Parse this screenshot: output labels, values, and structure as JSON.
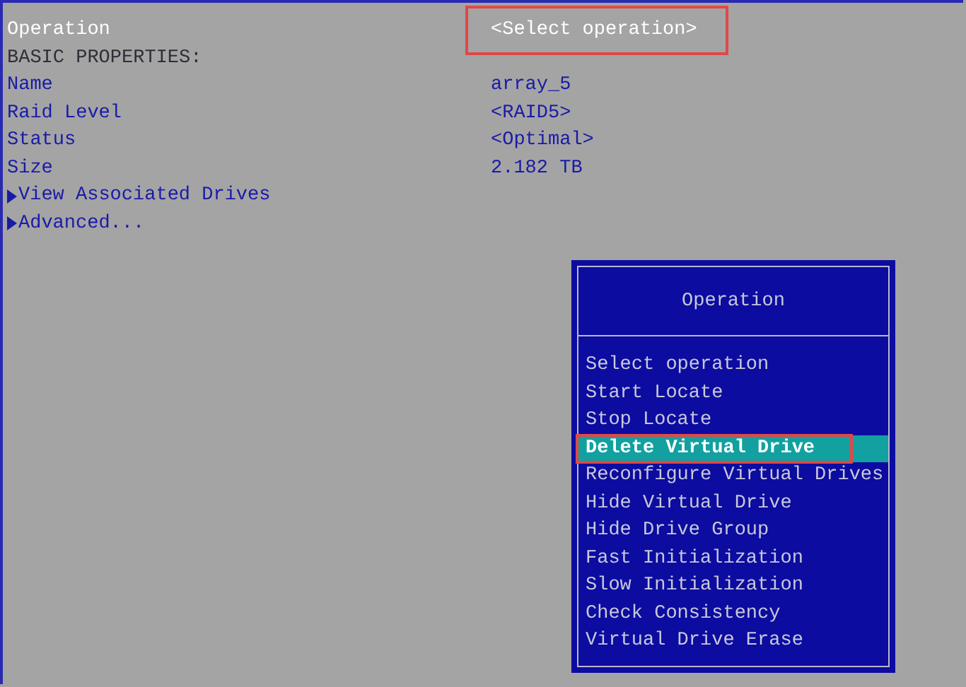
{
  "properties": [
    {
      "kind": "field",
      "label": "Operation",
      "value": "<Select operation>",
      "active": true,
      "marked": true
    },
    {
      "kind": "header",
      "label": "BASIC PROPERTIES:"
    },
    {
      "kind": "field",
      "label": "Name",
      "value": "array_5",
      "active": false,
      "marked": false
    },
    {
      "kind": "field",
      "label": "Raid Level",
      "value": "<RAID5>",
      "active": false,
      "marked": false
    },
    {
      "kind": "field",
      "label": "Status",
      "value": "<Optimal>",
      "active": false,
      "marked": false
    },
    {
      "kind": "field",
      "label": "Size",
      "value": "2.182 TB",
      "active": false,
      "marked": false
    },
    {
      "kind": "submenu",
      "label": "View Associated Drives"
    },
    {
      "kind": "submenu",
      "label": "Advanced..."
    }
  ],
  "popup": {
    "title": "Operation",
    "items": [
      {
        "label": "Select operation",
        "selected": false,
        "marked": false
      },
      {
        "label": "Start Locate",
        "selected": false,
        "marked": false
      },
      {
        "label": "Stop Locate",
        "selected": false,
        "marked": false
      },
      {
        "label": "Delete Virtual Drive",
        "selected": true,
        "marked": true
      },
      {
        "label": "Reconfigure Virtual Drives",
        "selected": false,
        "marked": false
      },
      {
        "label": "Hide Virtual Drive",
        "selected": false,
        "marked": false
      },
      {
        "label": "Hide Drive Group",
        "selected": false,
        "marked": false
      },
      {
        "label": "Fast Initialization",
        "selected": false,
        "marked": false
      },
      {
        "label": "Slow Initialization",
        "selected": false,
        "marked": false
      },
      {
        "label": "Check Consistency",
        "selected": false,
        "marked": false
      },
      {
        "label": "Virtual Drive Erase",
        "selected": false,
        "marked": false
      }
    ]
  }
}
